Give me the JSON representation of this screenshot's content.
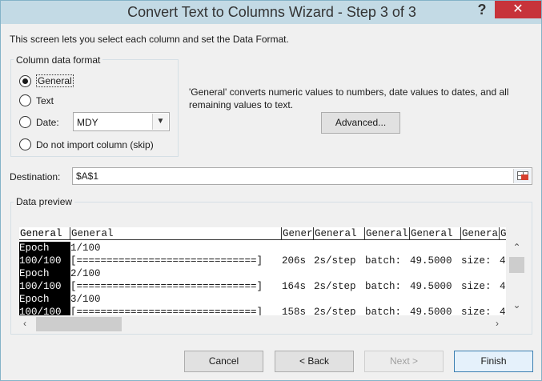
{
  "window": {
    "title": "Convert Text to Columns Wizard - Step 3 of 3",
    "help_label": "?",
    "close_label": "✕"
  },
  "intro_text": "This screen lets you select each column and set the Data Format.",
  "column_format": {
    "group_title": "Column data format",
    "options": [
      {
        "label": "General",
        "checked": true
      },
      {
        "label": "Text",
        "checked": false
      },
      {
        "label": "Date:",
        "checked": false
      },
      {
        "label": "Do not import column (skip)",
        "checked": false
      }
    ],
    "date_value": "MDY"
  },
  "description": "'General' converts numeric values to numbers, date values to dates, and all remaining values to text.",
  "advanced_label": "Advanced...",
  "destination": {
    "label": "Destination:",
    "value": "$A$1"
  },
  "preview": {
    "title": "Data preview",
    "headers": [
      "General",
      "General",
      "Gener",
      "General",
      "General",
      "General",
      "Genera",
      "G"
    ],
    "rows": [
      [
        "Epoch",
        "1/100",
        "",
        "",
        "",
        "",
        "",
        ""
      ],
      [
        "100/100",
        "[==============================]",
        "206s",
        "2s/step",
        "batch:",
        "49.5000",
        "size:",
        "4"
      ],
      [
        "Epoch",
        "2/100",
        "",
        "",
        "",
        "",
        "",
        ""
      ],
      [
        "100/100",
        "[==============================]",
        "164s",
        "2s/step",
        "batch:",
        "49.5000",
        "size:",
        "4"
      ],
      [
        "Epoch",
        "3/100",
        "",
        "",
        "",
        "",
        "",
        ""
      ],
      [
        "100/100",
        "[==============================]",
        "158s",
        "2s/step",
        "batch:",
        "49.5000",
        "size:",
        "4"
      ]
    ]
  },
  "buttons": {
    "cancel": "Cancel",
    "back": "< Back",
    "next": "Next >",
    "finish": "Finish"
  },
  "colors": {
    "titlebar": "#c3dae5",
    "close": "#c7333a",
    "selected_column": "#000000"
  }
}
